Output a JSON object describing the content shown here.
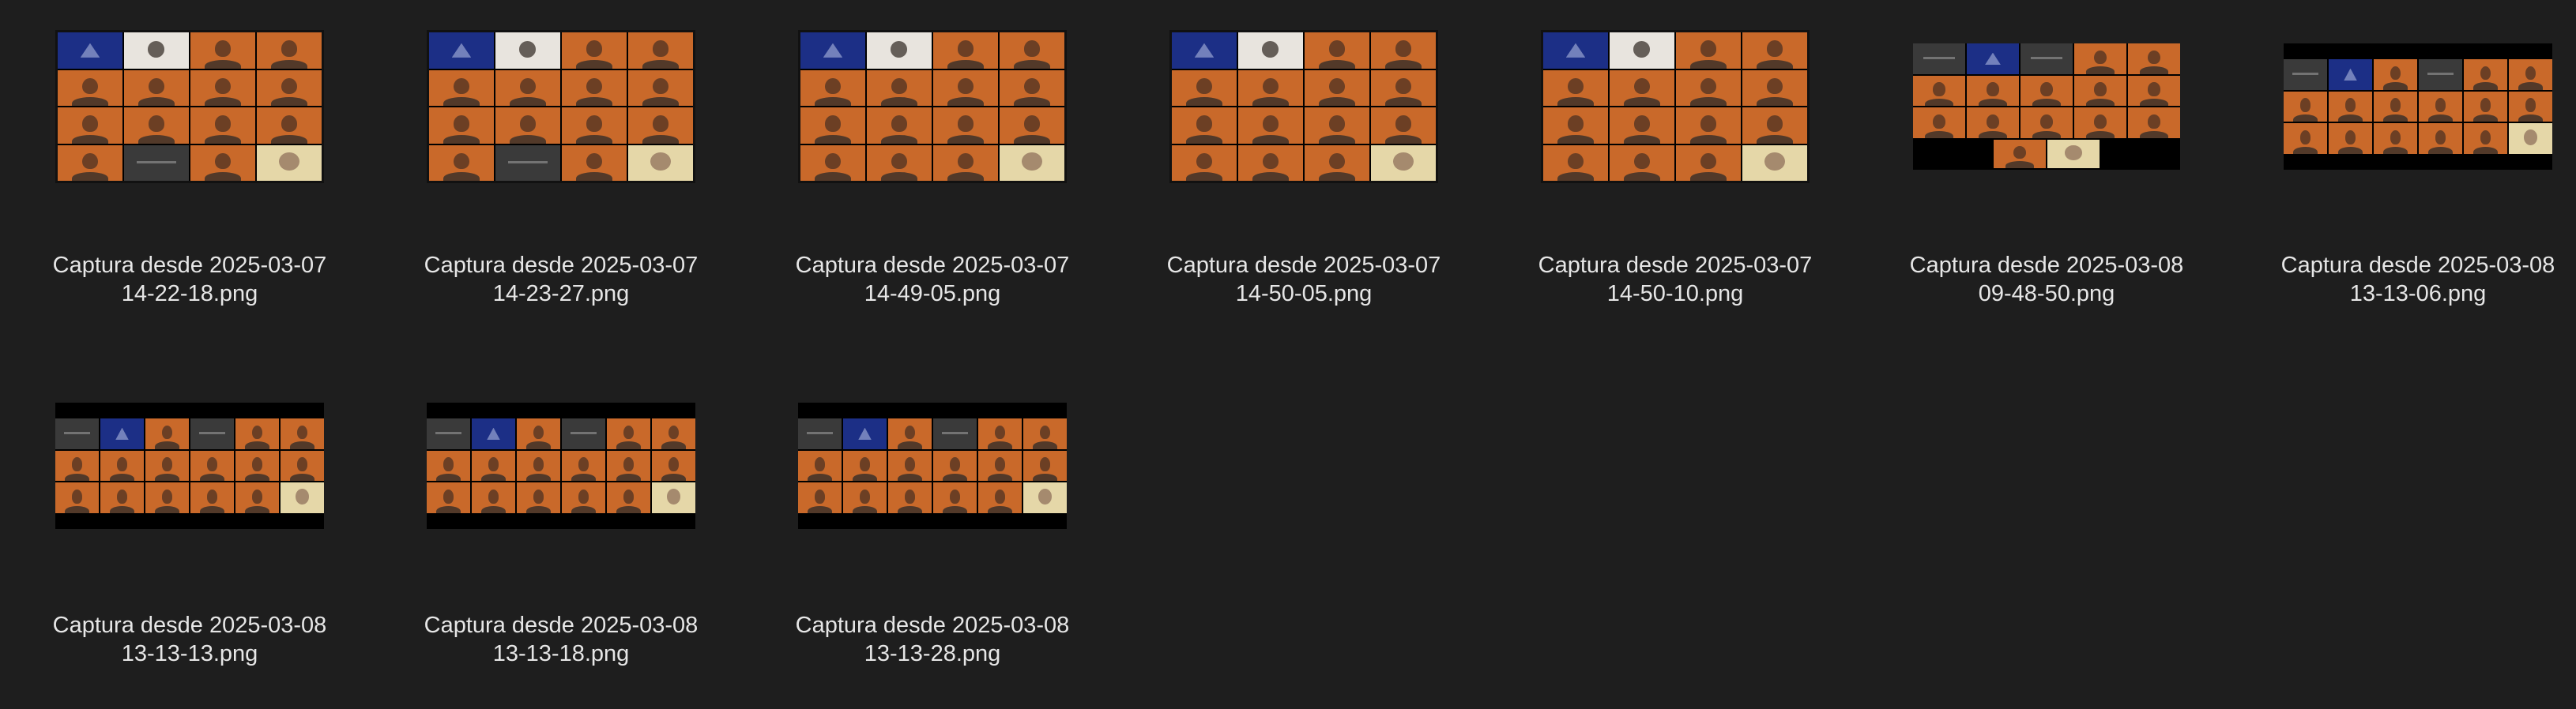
{
  "files": [
    {
      "name_line1": "Captura desde 2025-03-07",
      "name_line2": "14-22-18.png"
    },
    {
      "name_line1": "Captura desde 2025-03-07",
      "name_line2": "14-23-27.png"
    },
    {
      "name_line1": "Captura desde 2025-03-07",
      "name_line2": "14-49-05.png"
    },
    {
      "name_line1": "Captura desde 2025-03-07",
      "name_line2": "14-50-05.png"
    },
    {
      "name_line1": "Captura desde 2025-03-07",
      "name_line2": "14-50-10.png"
    },
    {
      "name_line1": "Captura desde 2025-03-08",
      "name_line2": "09-48-50.png"
    },
    {
      "name_line1": "Captura desde 2025-03-08",
      "name_line2": "13-13-06.png"
    },
    {
      "name_line1": "Captura desde 2025-03-08",
      "name_line2": "13-13-13.png"
    },
    {
      "name_line1": "Captura desde 2025-03-08",
      "name_line2": "13-13-18.png"
    },
    {
      "name_line1": "Captura desde 2025-03-08",
      "name_line2": "13-13-28.png"
    }
  ],
  "icons": {
    "thumbnail": "video-call-screenshot-thumbnail"
  },
  "colors": {
    "background": "#1e1e1e",
    "tile": "#c9692a",
    "text": "#e6e6e6"
  }
}
